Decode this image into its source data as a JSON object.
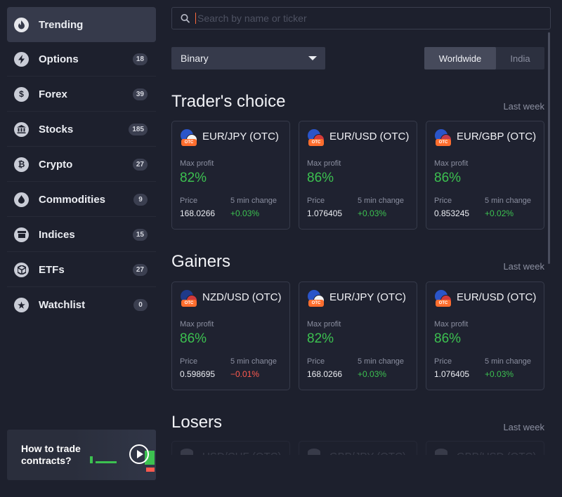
{
  "sidebar": {
    "items": [
      {
        "label": "Trending",
        "icon": "flame-icon",
        "badge": "",
        "active": true
      },
      {
        "label": "Options",
        "icon": "lightning-icon",
        "badge": "18"
      },
      {
        "label": "Forex",
        "icon": "dollar-icon",
        "badge": "39"
      },
      {
        "label": "Stocks",
        "icon": "bank-icon",
        "badge": "185"
      },
      {
        "label": "Crypto",
        "icon": "bitcoin-icon",
        "badge": "27"
      },
      {
        "label": "Commodities",
        "icon": "drop-icon",
        "badge": "9"
      },
      {
        "label": "Indices",
        "icon": "box-icon",
        "badge": "15"
      },
      {
        "label": "ETFs",
        "icon": "cube-icon",
        "badge": "27"
      },
      {
        "label": "Watchlist",
        "icon": "star-icon",
        "badge": "0"
      }
    ],
    "promo": {
      "title": "How to trade contracts?",
      "icon": "play-icon"
    }
  },
  "search": {
    "placeholder": "Search by name or ticker",
    "value": ""
  },
  "filter": {
    "selected": "Binary"
  },
  "region_toggle": {
    "options": [
      "Worldwide",
      "India"
    ],
    "selected": "Worldwide"
  },
  "colors": {
    "positive": "#3cc150",
    "negative": "#ff5a4f",
    "otc_badge": "#ff6e2e"
  },
  "labels": {
    "max_profit": "Max profit",
    "price": "Price",
    "change": "5 min change",
    "otc": "OTC"
  },
  "sections": [
    {
      "title": "Trader's choice",
      "link": "Last week",
      "cards": [
        {
          "pair": "EUR/JPY (OTC)",
          "profit": "82%",
          "price": "168.0266",
          "change": "+0.03%",
          "dir": "up"
        },
        {
          "pair": "EUR/USD (OTC)",
          "profit": "86%",
          "price": "1.076405",
          "change": "+0.03%",
          "dir": "up"
        },
        {
          "pair": "EUR/GBP (OTC)",
          "profit": "86%",
          "price": "0.853245",
          "change": "+0.02%",
          "dir": "up"
        }
      ]
    },
    {
      "title": "Gainers",
      "link": "Last week",
      "cards": [
        {
          "pair": "NZD/USD (OTC)",
          "profit": "86%",
          "price": "0.598695",
          "change": "−0.01%",
          "dir": "down"
        },
        {
          "pair": "EUR/JPY (OTC)",
          "profit": "82%",
          "price": "168.0266",
          "change": "+0.03%",
          "dir": "up"
        },
        {
          "pair": "EUR/USD (OTC)",
          "profit": "86%",
          "price": "1.076405",
          "change": "+0.03%",
          "dir": "up"
        }
      ]
    },
    {
      "title": "Losers",
      "link": "Last week",
      "cards": [
        {
          "pair": "USD/CHF (OTC)"
        },
        {
          "pair": "GBP/JPY (OTC)"
        },
        {
          "pair": "GBP/USD (OTC)"
        }
      ]
    }
  ]
}
